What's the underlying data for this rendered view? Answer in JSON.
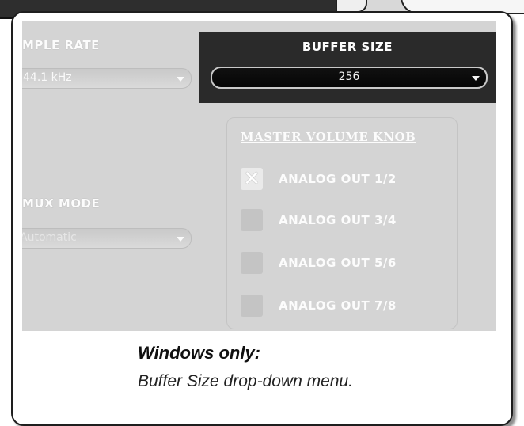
{
  "panel": {
    "sample_rate": {
      "label": "MPLE RATE",
      "value": "44.1 kHz"
    },
    "buffer_size": {
      "label": "BUFFER SIZE",
      "value": "256"
    },
    "mux_mode": {
      "label": "MUX MODE",
      "value": "Automatic"
    },
    "master_volume": {
      "title": "MASTER VOLUME KNOB",
      "outputs": [
        {
          "label": "ANALOG OUT 1/2",
          "checked": true
        },
        {
          "label": "ANALOG OUT 3/4",
          "checked": false
        },
        {
          "label": "ANALOG OUT 5/6",
          "checked": false
        },
        {
          "label": "ANALOG OUT 7/8",
          "checked": false
        }
      ]
    }
  },
  "caption": {
    "heading": "Windows only:",
    "text": "Buffer Size drop-down menu."
  }
}
